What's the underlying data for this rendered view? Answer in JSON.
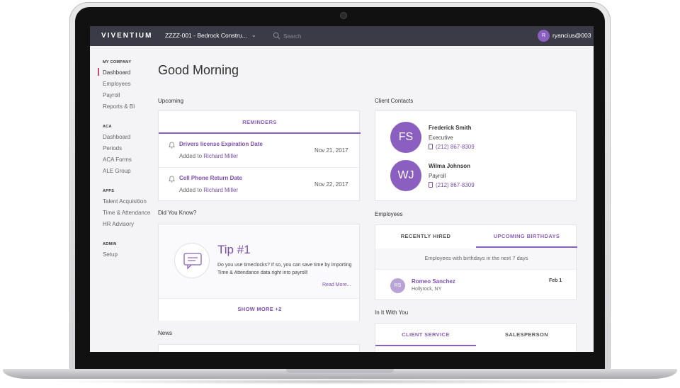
{
  "header": {
    "logo": "VIVENTIUM",
    "company": "ZZZZ-001 - Bedrock Constru...",
    "search_placeholder": "Search",
    "user_initial": "R",
    "user_name": "ryancius@003"
  },
  "sidebar": {
    "sections": [
      {
        "title": "MY COMPANY",
        "items": [
          "Dashboard",
          "Employees",
          "Payroll",
          "Reports & BI"
        ]
      },
      {
        "title": "ACA",
        "items": [
          "Dashboard",
          "Periods",
          "ACA Forms",
          "ALE Group"
        ]
      },
      {
        "title": "APPS",
        "items": [
          "Talent Acquisition",
          "Time & Attendance",
          "HR Advisory"
        ]
      },
      {
        "title": "ADMIN",
        "items": [
          "Setup"
        ]
      }
    ]
  },
  "main": {
    "greeting": "Good Morning",
    "upcoming": {
      "title": "Upcoming",
      "tab": "REMINDERS",
      "items": [
        {
          "title": "Drivers license Expiration Date",
          "added_prefix": "Added to",
          "person": "Richard Miller",
          "date": "Nov 21, 2017"
        },
        {
          "title": "Cell Phone Return Date",
          "added_prefix": "Added to",
          "person": "Richard Miller",
          "date": "Nov 22, 2017"
        }
      ]
    },
    "did_you_know": {
      "title": "Did You Know?",
      "tip_title": "Tip #1",
      "tip_text": "Do you use timeclocks? If so, you can save time by importing Time & Attendance data right into payroll!",
      "read_more": "Read More...",
      "show_more": "SHOW MORE +2"
    },
    "news": {
      "title": "News"
    },
    "client_contacts": {
      "title": "Client Contacts",
      "contacts": [
        {
          "initials": "FS",
          "name": "Frederick Smith",
          "role": "Executive",
          "phone": "(212) 867-8309"
        },
        {
          "initials": "WJ",
          "name": "Wilma Johnson",
          "role": "Payroll",
          "phone": "(212) 867-8309"
        }
      ]
    },
    "employees": {
      "title": "Employees",
      "tabs": [
        "RECENTLY HIRED",
        "UPCOMING BIRTHDAYS"
      ],
      "caption": "Employees with birthdays in the next 7 days",
      "items": [
        {
          "initials": "RS",
          "name": "Romeo Sanchez",
          "location": "Hollyrock, NY",
          "date": "Feb 1"
        }
      ]
    },
    "in_it_with_you": {
      "title": "In It With You",
      "tabs": [
        "CLIENT SERVICE",
        "SALESPERSON"
      ]
    }
  },
  "colors": {
    "accent": "#8b5fbf",
    "topbar": "#3b3b47",
    "active_marker": "#c84b6f"
  }
}
